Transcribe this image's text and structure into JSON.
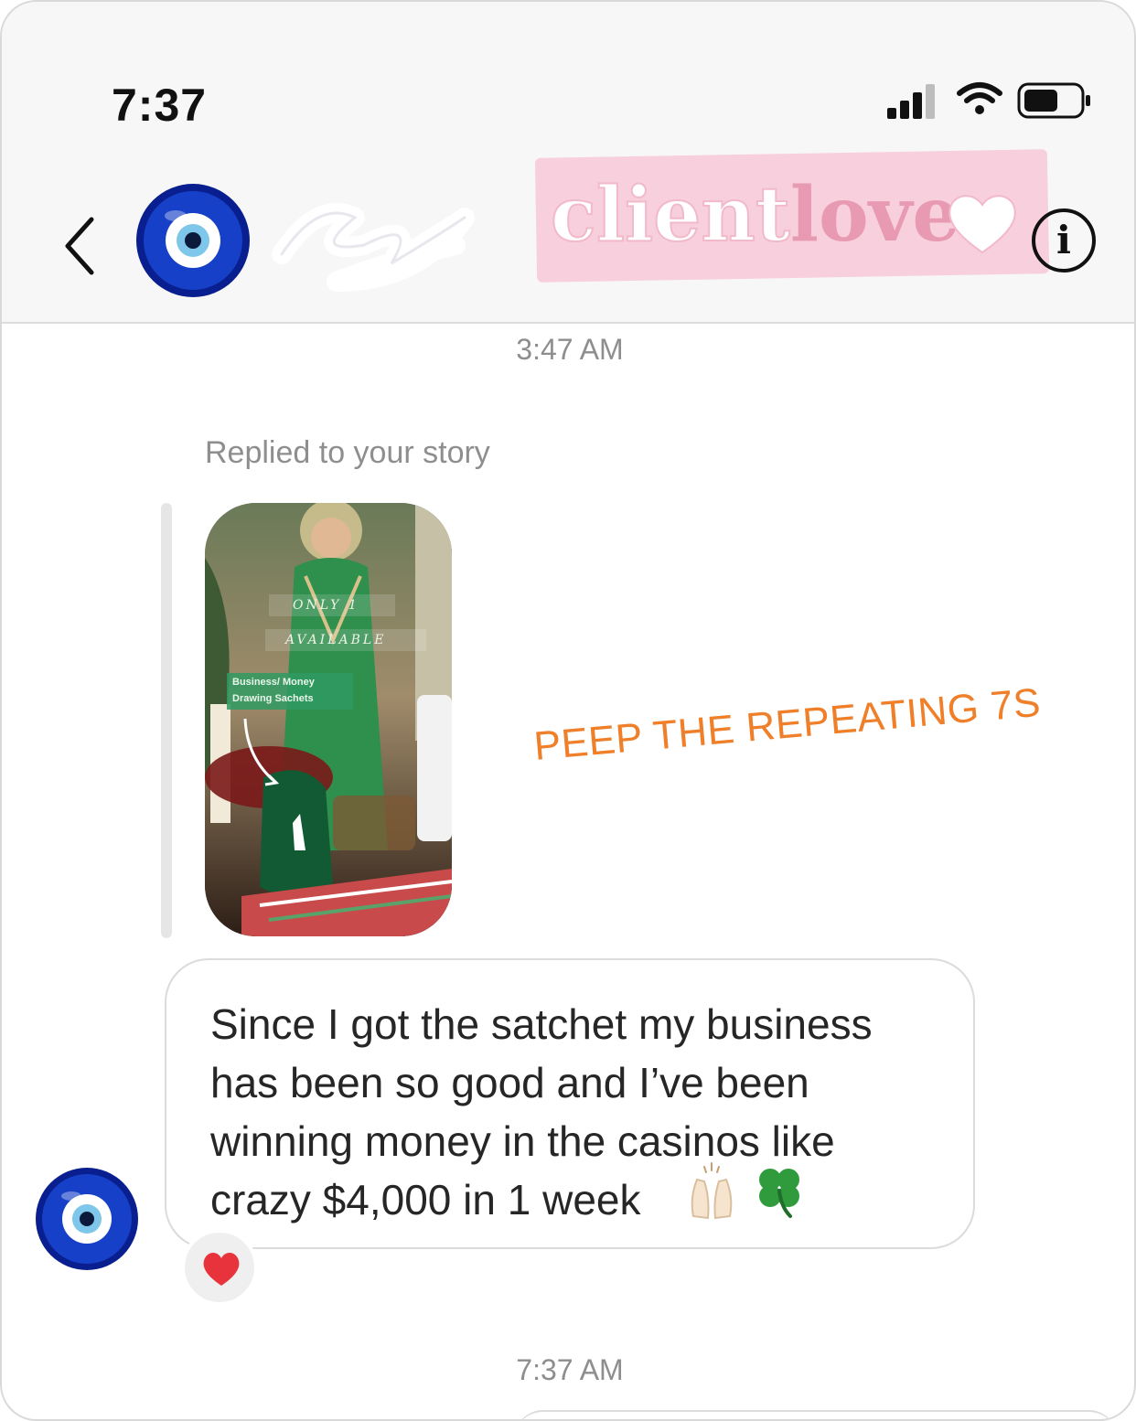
{
  "status_bar": {
    "time": "7:37"
  },
  "header": {
    "sticker_word1": "client",
    "sticker_word2": "love",
    "info_label": "i"
  },
  "thread": {
    "timestamp_top": "3:47 AM",
    "reply_label": "Replied to your story",
    "story_caption": "PEEP THE REPEATING 7S",
    "story_thumb_text": [
      "ONLY 1",
      "AVAILABLE",
      "Business/ Money",
      "Drawing Sachets"
    ],
    "message_text": "Since I got the satchet my business has been so good and I’ve been winning money in the casinos like crazy $4,000 in 1 week",
    "reaction": "heart-reaction",
    "timestamp_bottom": "7:37 AM"
  },
  "colors": {
    "caption_orange": "#f07f2a",
    "sticker_pink": "#f8cfdc",
    "evil_eye_blue": "#1230a8",
    "timestamp_gray": "#8e8e8e",
    "heart_red": "#e8323c"
  }
}
